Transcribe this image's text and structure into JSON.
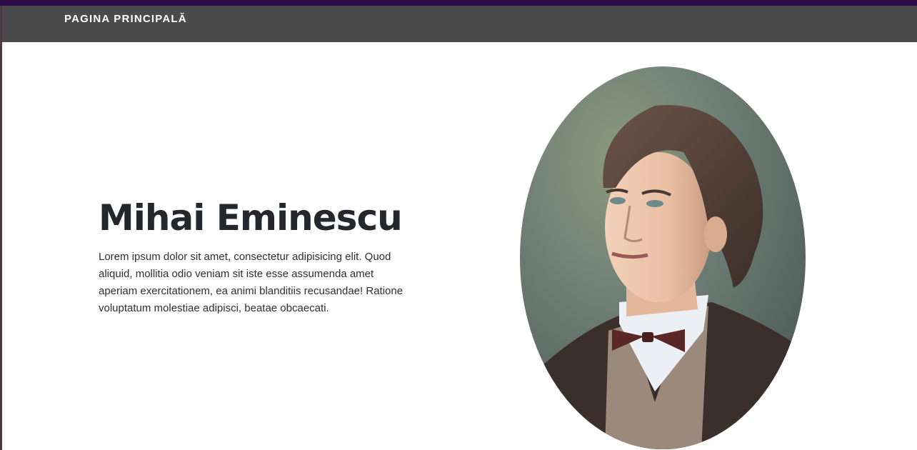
{
  "nav": {
    "home_label": "PAGINA PRINCIPALĂ"
  },
  "hero": {
    "title": "Mihai Eminescu",
    "text": "Lorem ipsum dolor sit amet, consectetur adipisicing elit. Quod aliquid, mollitia odio veniam sit iste esse assumenda amet aperiam exercitationem, ea animi blanditiis recusandae! Ratione voluptatum molestiae adipisci, beatae obcaecati."
  },
  "colors": {
    "top_accent": "#2b0a45",
    "navbar_bg": "#4b4b4b",
    "title_text": "#26272c"
  }
}
